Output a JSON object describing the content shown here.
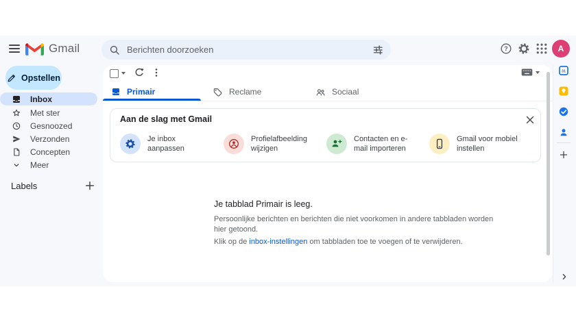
{
  "colors": {
    "accent_blue": "#0b57d0",
    "app_background": "#f6f8fc",
    "search_background": "#eaf1fb",
    "compose_background": "#c2e7ff",
    "selected_item_background": "#d3e3fd",
    "avatar_pink": "#dd3e74",
    "link_blue": "#0b57d0"
  },
  "header": {
    "brand": "Gmail",
    "search_placeholder": "Berichten doorzoeken",
    "help_glyph": "?",
    "avatar_initial": "A"
  },
  "sidebar": {
    "compose_label": "Opstellen",
    "items": [
      {
        "label": "Inbox",
        "active": true
      },
      {
        "label": "Met ster",
        "active": false
      },
      {
        "label": "Gesnoozed",
        "active": false
      },
      {
        "label": "Verzonden",
        "active": false
      },
      {
        "label": "Concepten",
        "active": false
      },
      {
        "label": "Meer",
        "active": false
      }
    ],
    "labels_heading": "Labels"
  },
  "tabs": [
    {
      "label": "Primair",
      "active": true
    },
    {
      "label": "Reclame",
      "active": false
    },
    {
      "label": "Sociaal",
      "active": false
    }
  ],
  "onboarding": {
    "title": "Aan de slag met Gmail",
    "items": [
      {
        "icon": "gear-icon",
        "line1": "Je inbox",
        "line2": "aanpassen",
        "circle_color": "#d3e3fc"
      },
      {
        "icon": "profile-icon",
        "line1": "Profielafbeelding",
        "line2": "wijzigen",
        "circle_color": "#fadcd9"
      },
      {
        "icon": "person-add-icon",
        "line1": "Contacten en e-",
        "line2": "mail importeren",
        "circle_color": "#ceead3"
      },
      {
        "icon": "phone-icon",
        "line1": "Gmail voor mobiel",
        "line2": "instellen",
        "circle_color": "#feefc3"
      }
    ]
  },
  "empty_state": {
    "title": "Je tabblad Primair is leeg.",
    "body_line1": "Persoonlijke berichten en berichten die niet voorkomen in andere tabbladen worden",
    "body_line2": "hier getoond.",
    "cta_prefix": "Klik op de ",
    "cta_link": "inbox-instellingen",
    "cta_suffix": " om tabbladen toe te voegen of te verwijderen."
  },
  "side_panel": {
    "calendar_day": "31"
  }
}
